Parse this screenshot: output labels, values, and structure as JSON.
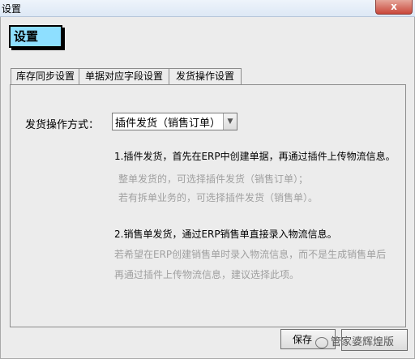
{
  "window": {
    "title": "设置",
    "close_label": "x"
  },
  "header": {
    "label": "设置"
  },
  "tabs": [
    {
      "label": "库存同步设置"
    },
    {
      "label": "单据对应字段设置"
    },
    {
      "label": "发货操作设置"
    }
  ],
  "shipping": {
    "method_label": "发货操作方式：",
    "method_value": "插件发货（销售订单）",
    "desc1": "1.插件发货，首先在ERP中创建单据，再通过插件上传物流信息。",
    "desc1_sub1": "整单发货的，可选择插件发货（销售订单）；",
    "desc1_sub2": "若有拆单业务的，可选择插件发货（销售单）。",
    "desc2": "2.销售单发货，通过ERP销售单直接录入物流信息。",
    "desc2_sub1": "若希望在ERP创建销售单时录入物流信息，而不是生成销售单后",
    "desc2_sub2": "再通过插件上传物流信息，建议选择此项。"
  },
  "buttons": {
    "save_label": "保存"
  },
  "watermark": {
    "text": "管家婆辉煌版"
  }
}
